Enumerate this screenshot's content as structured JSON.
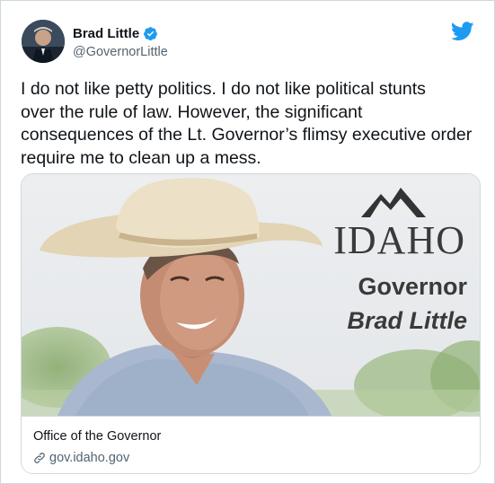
{
  "author": {
    "display_name": "Brad Little",
    "handle": "@GovernorLittle",
    "verified": true
  },
  "icons": {
    "verified": "verified-badge-icon",
    "brand": "twitter-bird-icon",
    "link": "link-icon"
  },
  "tweet": {
    "text": "I do not like petty politics. I do not like political stunts\nover the rule of law. However, the significant\nconsequences of the Lt. Governor’s flimsy executive order\nrequire me to clean up a mess."
  },
  "card": {
    "image": {
      "logo_text": "IDAHO",
      "title": "Governor",
      "name": "Brad Little"
    },
    "title": "Office of the Governor",
    "domain": "gov.idaho.gov"
  },
  "colors": {
    "twitter_blue": "#1d9bf0",
    "text_primary": "#0f1419",
    "text_secondary": "#536471",
    "border": "#cfd9de"
  }
}
